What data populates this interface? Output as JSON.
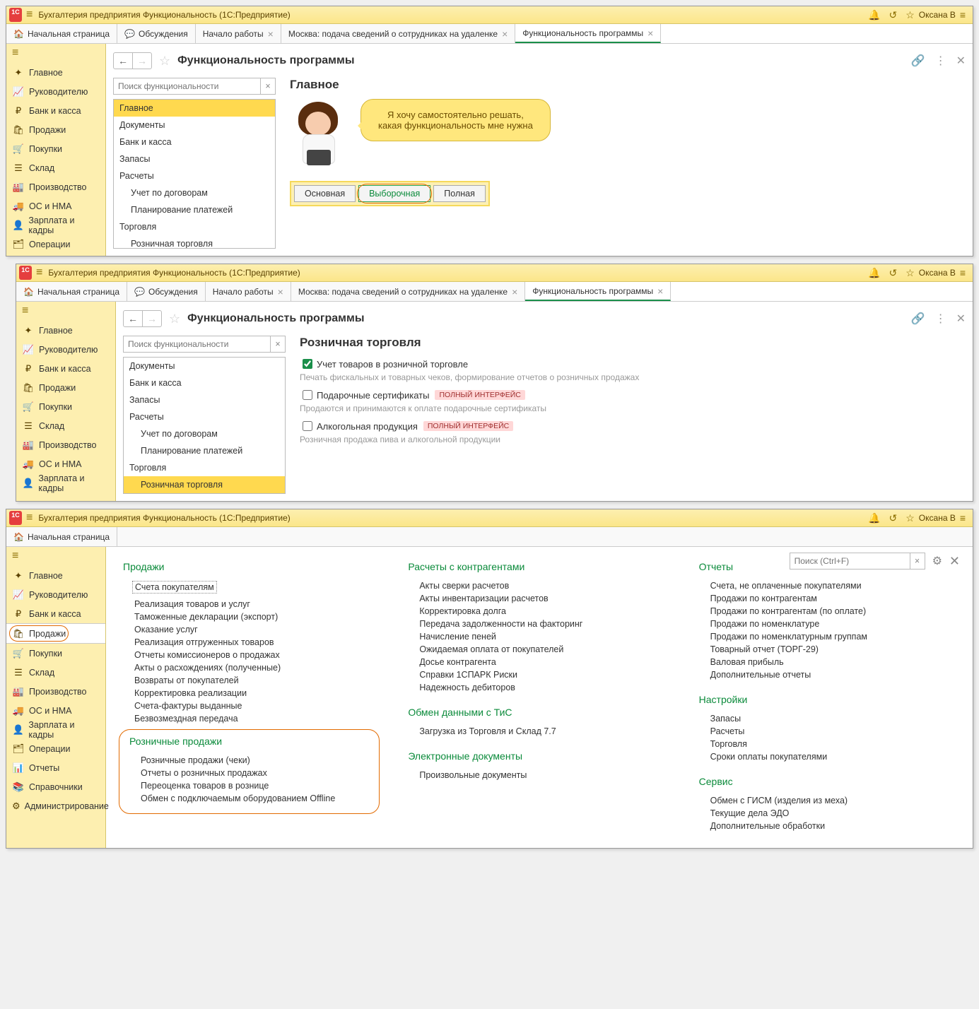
{
  "common": {
    "app_title": "Бухгалтерия предприятия Функциональность  (1С:Предприятие)",
    "user": "Оксана В",
    "tabs": {
      "home": "Начальная страница",
      "discuss": "Обсуждения",
      "start": "Начало работы",
      "remote": "Москва: подача сведений о сотрудниках на удаленке",
      "func": "Функциональность программы"
    },
    "sidebar": [
      "Главное",
      "Руководителю",
      "Банк и касса",
      "Продажи",
      "Покупки",
      "Склад",
      "Производство",
      "ОС и НМА",
      "Зарплата и кадры",
      "Операции",
      "Отчеты",
      "Справочники",
      "Администрирование"
    ],
    "sidebar_icons": [
      "✦",
      "📈",
      "₽",
      "🛍",
      "🛒",
      "☰",
      "🏭",
      "🚚",
      "👤",
      "🗂",
      "📊",
      "📚",
      "⚙"
    ],
    "page_title": "Функциональность программы",
    "search_placeholder": "Поиск функциональности"
  },
  "w1": {
    "tree": [
      "Главное",
      "Документы",
      "Банк и касса",
      "Запасы",
      "Расчеты",
      "Учет по договорам",
      "Планирование платежей",
      "Торговля",
      "Розничная торговля"
    ],
    "tree_sub": [
      false,
      false,
      false,
      false,
      false,
      true,
      true,
      false,
      true
    ],
    "tree_sel_index": 0,
    "section_title": "Главное",
    "bubble_l1": "Я хочу самостоятельно решать,",
    "bubble_l2": "какая функциональность мне нужна",
    "modes": [
      "Основная",
      "Выборочная",
      "Полная"
    ]
  },
  "w2": {
    "tree": [
      "Документы",
      "Банк и касса",
      "Запасы",
      "Расчеты",
      "Учет по договорам",
      "Планирование платежей",
      "Торговля",
      "Розничная торговля"
    ],
    "tree_sub": [
      false,
      false,
      false,
      false,
      true,
      true,
      false,
      true
    ],
    "tree_sel_index": 7,
    "section_title": "Розничная торговля",
    "chk1": "Учет товаров в розничной торговле",
    "desc1": "Печать фискальных и товарных чеков, формирование отчетов о розничных продажах",
    "chk2": "Подарочные сертификаты",
    "desc2": "Продаются и принимаются к оплате подарочные сертификаты",
    "chk3": "Алкогольная продукция",
    "desc3": "Розничная продажа пива и алкогольной продукции",
    "badge": "ПОЛНЫЙ ИНТЕРФЕЙС"
  },
  "w3": {
    "search_placeholder": "Поиск (Ctrl+F)",
    "col1": {
      "h1": "Продажи",
      "items1": [
        "Счета покупателям",
        "Реализация товаров и услуг",
        "Таможенные декларации (экспорт)",
        "Оказание услуг",
        "Реализация отгруженных товаров",
        "Отчеты комиссионеров о продажах",
        "Акты о расхождениях (полученные)",
        "Возвраты от покупателей",
        "Корректировка реализации",
        "Счета-фактуры выданные",
        "Безвозмездная передача"
      ],
      "h2": "Розничные продажи",
      "items2": [
        "Розничные продажи (чеки)",
        "Отчеты о розничных продажах",
        "Переоценка товаров в рознице",
        "Обмен с подключаемым оборудованием Offline"
      ]
    },
    "col2": {
      "h1": "Расчеты с контрагентами",
      "items1": [
        "Акты сверки расчетов",
        "Акты инвентаризации расчетов",
        "Корректировка долга",
        "Передача задолженности на факторинг",
        "Начисление пеней",
        "Ожидаемая оплата от покупателей",
        "Досье контрагента",
        "Справки 1СПАРК Риски",
        "Надежность дебиторов"
      ],
      "h2": "Обмен данными с ТиС",
      "items2": [
        "Загрузка из Торговля и Склад 7.7"
      ],
      "h3": "Электронные документы",
      "items3": [
        "Произвольные документы"
      ]
    },
    "col3": {
      "h1": "Отчеты",
      "items1": [
        "Счета, не оплаченные покупателями",
        "Продажи по контрагентам",
        "Продажи по контрагентам (по оплате)",
        "Продажи по номенклатуре",
        "Продажи по номенклатурным группам",
        "Товарный отчет (ТОРГ-29)",
        "Валовая прибыль",
        "Дополнительные отчеты"
      ],
      "h2": "Настройки",
      "items2": [
        "Запасы",
        "Расчеты",
        "Торговля",
        "Сроки оплаты покупателями"
      ],
      "h3": "Сервис",
      "items3": [
        "Обмен с ГИСМ (изделия из меха)",
        "Текущие дела ЭДО",
        "Дополнительные обработки"
      ]
    }
  }
}
